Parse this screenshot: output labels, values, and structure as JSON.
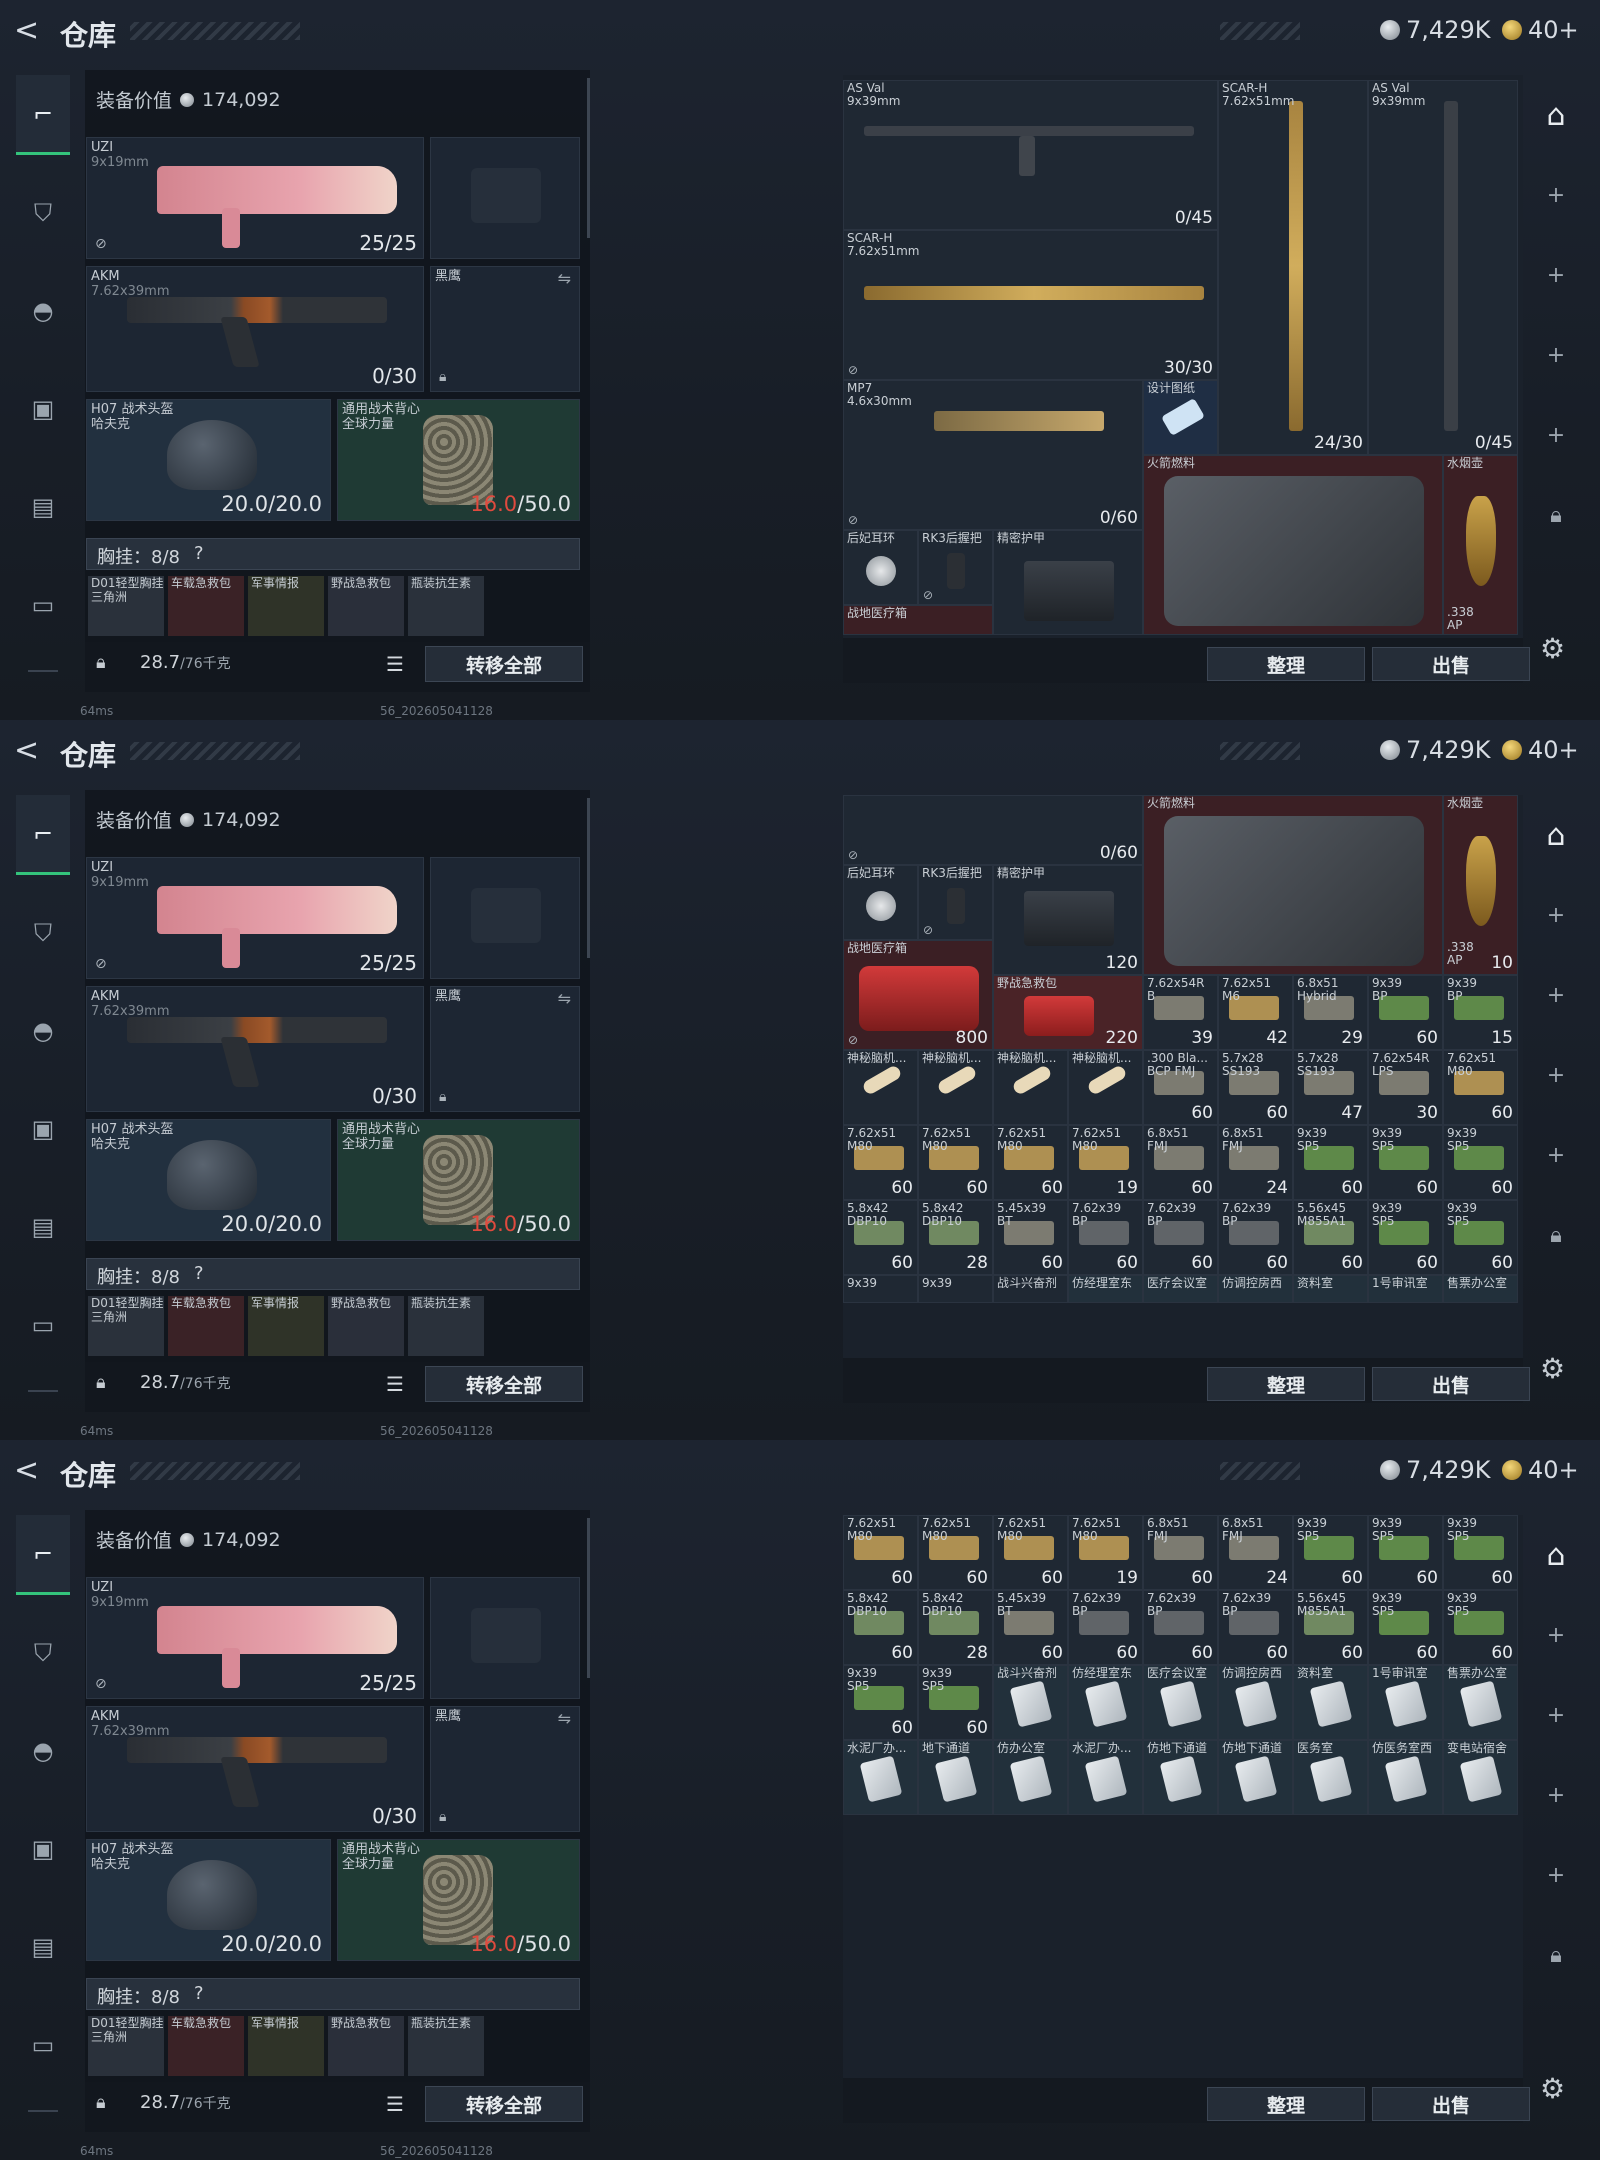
{
  "header": {
    "back_glyph": "<",
    "title": "仓库",
    "silver_amount": "7,429K",
    "gold_amount": "40+"
  },
  "left": {
    "equip_value_label": "装备价值",
    "equip_value": "174,092",
    "slots": {
      "primary_name": "UZI",
      "primary_sub": "9x19mm",
      "primary_ammo": "25/25",
      "secondary_name": "AKM",
      "secondary_sub": "7.62x39mm",
      "secondary_ammo": "0/30",
      "skin_name": "黑鹰",
      "helmet_name": "H07 战术头盔",
      "helmet_sub": "哈夫克",
      "helmet_dur": "20.0/20.0",
      "vest_name": "通用战术背心",
      "vest_sub": "全球力量",
      "vest_dur_cur": "16.0",
      "vest_dur_max": "/50.0"
    },
    "chest_label": "胸挂：",
    "chest_count": "8/8",
    "chest_help": "?",
    "chest_items": [
      "D01轻型胸挂",
      "车载急救包",
      "军事情报",
      "野战急救包",
      "瓶装抗生素"
    ],
    "chest_sub": "三角洲",
    "weight": "28.7",
    "weight_unit": "/76千克",
    "transfer_all": "转移全部"
  },
  "stash": {
    "sort_btn": "整理",
    "sell_btn": "出售"
  },
  "status": {
    "ping": "64ms",
    "build": "56_202605041128"
  },
  "p1": {
    "asval1_name": "AS Val",
    "asval1_sub": "9x39mm",
    "asval1_cnt": "0/45",
    "scarh_v_name": "SCAR-H",
    "scarh_v_sub": "7.62x51mm",
    "scarh_v_cnt": "24/30",
    "asval2_name": "AS Val",
    "asval2_sub": "9x39mm",
    "asval2_cnt": "0/45",
    "scarh_name": "SCAR-H",
    "scarh_sub": "7.62x51mm",
    "scarh_cnt": "30/30",
    "mp7_name": "MP7",
    "mp7_sub": "4.6x30mm",
    "mp7_cnt": "0/60",
    "design": "设计图纸",
    "fuel": "火箭燃料",
    "hookah": "水烟壶",
    "earring": "后妃耳环",
    "grip": "RK3后握把",
    "armor": "精密护甲",
    "medbox": "战地医疗箱",
    "ammo338": ".338",
    "ammo338b": "AP"
  },
  "p2": {
    "mp7_cnt": "0/60",
    "fuel": "火箭燃料",
    "hookah": "水烟壶",
    "earring": "后妃耳环",
    "grip": "RK3后握把",
    "armor": "精密护甲",
    "armor_cnt": "120",
    "medbox": "战地医疗箱",
    "medbox_cnt": "800",
    "kit": "野战急救包",
    "kit_cnt": "220",
    "ammo338": ".338",
    "ammo338b": "AP",
    "ammo338_cnt": "10",
    "row1": [
      {
        "n": "7.62x54R",
        "s": "B",
        "c": "39"
      },
      {
        "n": "7.62x51",
        "s": "M6",
        "c": "42"
      },
      {
        "n": "6.8x51",
        "s": "Hybrid",
        "c": "29"
      },
      {
        "n": "9x39",
        "s": "BP",
        "c": "60"
      },
      {
        "n": "9x39",
        "s": "BP",
        "c": "15"
      }
    ],
    "row2": [
      {
        "n": "神秘脑机...",
        "s": "",
        "c": ""
      },
      {
        "n": "神秘脑机...",
        "s": "",
        "c": ""
      },
      {
        "n": "神秘脑机...",
        "s": "",
        "c": ""
      },
      {
        "n": "神秘脑机...",
        "s": "",
        "c": ""
      },
      {
        "n": ".300 Bla...",
        "s": "BCP FMJ",
        "c": "60"
      },
      {
        "n": "5.7x28",
        "s": "SS193",
        "c": "60"
      },
      {
        "n": "5.7x28",
        "s": "SS193",
        "c": "47"
      },
      {
        "n": "7.62x54R",
        "s": "LPS",
        "c": "30"
      },
      {
        "n": "7.62x51",
        "s": "M80",
        "c": "60"
      }
    ],
    "row3": [
      {
        "n": "7.62x51",
        "s": "M80",
        "c": "60"
      },
      {
        "n": "7.62x51",
        "s": "M80",
        "c": "60"
      },
      {
        "n": "7.62x51",
        "s": "M80",
        "c": "60"
      },
      {
        "n": "7.62x51",
        "s": "M80",
        "c": "19"
      },
      {
        "n": "6.8x51",
        "s": "FMJ",
        "c": "60"
      },
      {
        "n": "6.8x51",
        "s": "FMJ",
        "c": "24"
      },
      {
        "n": "9x39",
        "s": "SP5",
        "c": "60"
      },
      {
        "n": "9x39",
        "s": "SP5",
        "c": "60"
      },
      {
        "n": "9x39",
        "s": "SP5",
        "c": "60"
      }
    ],
    "row4": [
      {
        "n": "5.8x42",
        "s": "DBP10",
        "c": "60"
      },
      {
        "n": "5.8x42",
        "s": "DBP10",
        "c": "28"
      },
      {
        "n": "5.45x39",
        "s": "BT",
        "c": "60"
      },
      {
        "n": "7.62x39",
        "s": "BP",
        "c": "60"
      },
      {
        "n": "7.62x39",
        "s": "BP",
        "c": "60"
      },
      {
        "n": "7.62x39",
        "s": "BP",
        "c": "60"
      },
      {
        "n": "5.56x45",
        "s": "M855A1",
        "c": "60"
      },
      {
        "n": "9x39",
        "s": "SP5",
        "c": "60"
      },
      {
        "n": "9x39",
        "s": "SP5",
        "c": "60"
      }
    ],
    "row5": [
      "9x39",
      "9x39",
      "战斗兴奋剂",
      "仿经理室东",
      "医疗会议室",
      "仿调控房西",
      "资料室",
      "1号审讯室",
      "售票办公室"
    ]
  },
  "p3": {
    "row0": [
      {
        "n": "7.62x51",
        "s": "M80",
        "c": "60"
      },
      {
        "n": "7.62x51",
        "s": "M80",
        "c": "60"
      },
      {
        "n": "7.62x51",
        "s": "M80",
        "c": "60"
      },
      {
        "n": "7.62x51",
        "s": "M80",
        "c": "19"
      },
      {
        "n": "6.8x51",
        "s": "FMJ",
        "c": "60"
      },
      {
        "n": "6.8x51",
        "s": "FMJ",
        "c": "24"
      },
      {
        "n": "9x39",
        "s": "SP5",
        "c": "60"
      },
      {
        "n": "9x39",
        "s": "SP5",
        "c": "60"
      },
      {
        "n": "9x39",
        "s": "SP5",
        "c": "60"
      }
    ],
    "row1": [
      {
        "n": "5.8x42",
        "s": "DBP10",
        "c": "60"
      },
      {
        "n": "5.8x42",
        "s": "DBP10",
        "c": "28"
      },
      {
        "n": "5.45x39",
        "s": "BT",
        "c": "60"
      },
      {
        "n": "7.62x39",
        "s": "BP",
        "c": "60"
      },
      {
        "n": "7.62x39",
        "s": "BP",
        "c": "60"
      },
      {
        "n": "7.62x39",
        "s": "BP",
        "c": "60"
      },
      {
        "n": "5.56x45",
        "s": "M855A1",
        "c": "60"
      },
      {
        "n": "9x39",
        "s": "SP5",
        "c": "60"
      },
      {
        "n": "9x39",
        "s": "SP5",
        "c": "60"
      }
    ],
    "row2": [
      {
        "n": "9x39",
        "s": "SP5",
        "c": "60"
      },
      {
        "n": "9x39",
        "s": "SP5",
        "c": "60"
      },
      {
        "n": "战斗兴奋剂",
        "s": "",
        "c": ""
      },
      {
        "n": "仿经理室东",
        "s": "",
        "c": ""
      },
      {
        "n": "医疗会议室",
        "s": "",
        "c": ""
      },
      {
        "n": "仿调控房西",
        "s": "",
        "c": ""
      },
      {
        "n": "资料室",
        "s": "",
        "c": ""
      },
      {
        "n": "1号审讯室",
        "s": "",
        "c": ""
      },
      {
        "n": "售票办公室",
        "s": "",
        "c": ""
      }
    ],
    "row3": [
      {
        "n": "水泥厂办...",
        "s": "",
        "c": ""
      },
      {
        "n": "地下通道",
        "s": "",
        "c": ""
      },
      {
        "n": "仿办公室",
        "s": "",
        "c": ""
      },
      {
        "n": "水泥厂办...",
        "s": "",
        "c": ""
      },
      {
        "n": "仿地下通道",
        "s": "",
        "c": ""
      },
      {
        "n": "仿地下通道",
        "s": "",
        "c": ""
      },
      {
        "n": "医务室",
        "s": "",
        "c": ""
      },
      {
        "n": "仿医务室西",
        "s": "",
        "c": ""
      },
      {
        "n": "变电站宿舍",
        "s": "",
        "c": ""
      }
    ]
  }
}
